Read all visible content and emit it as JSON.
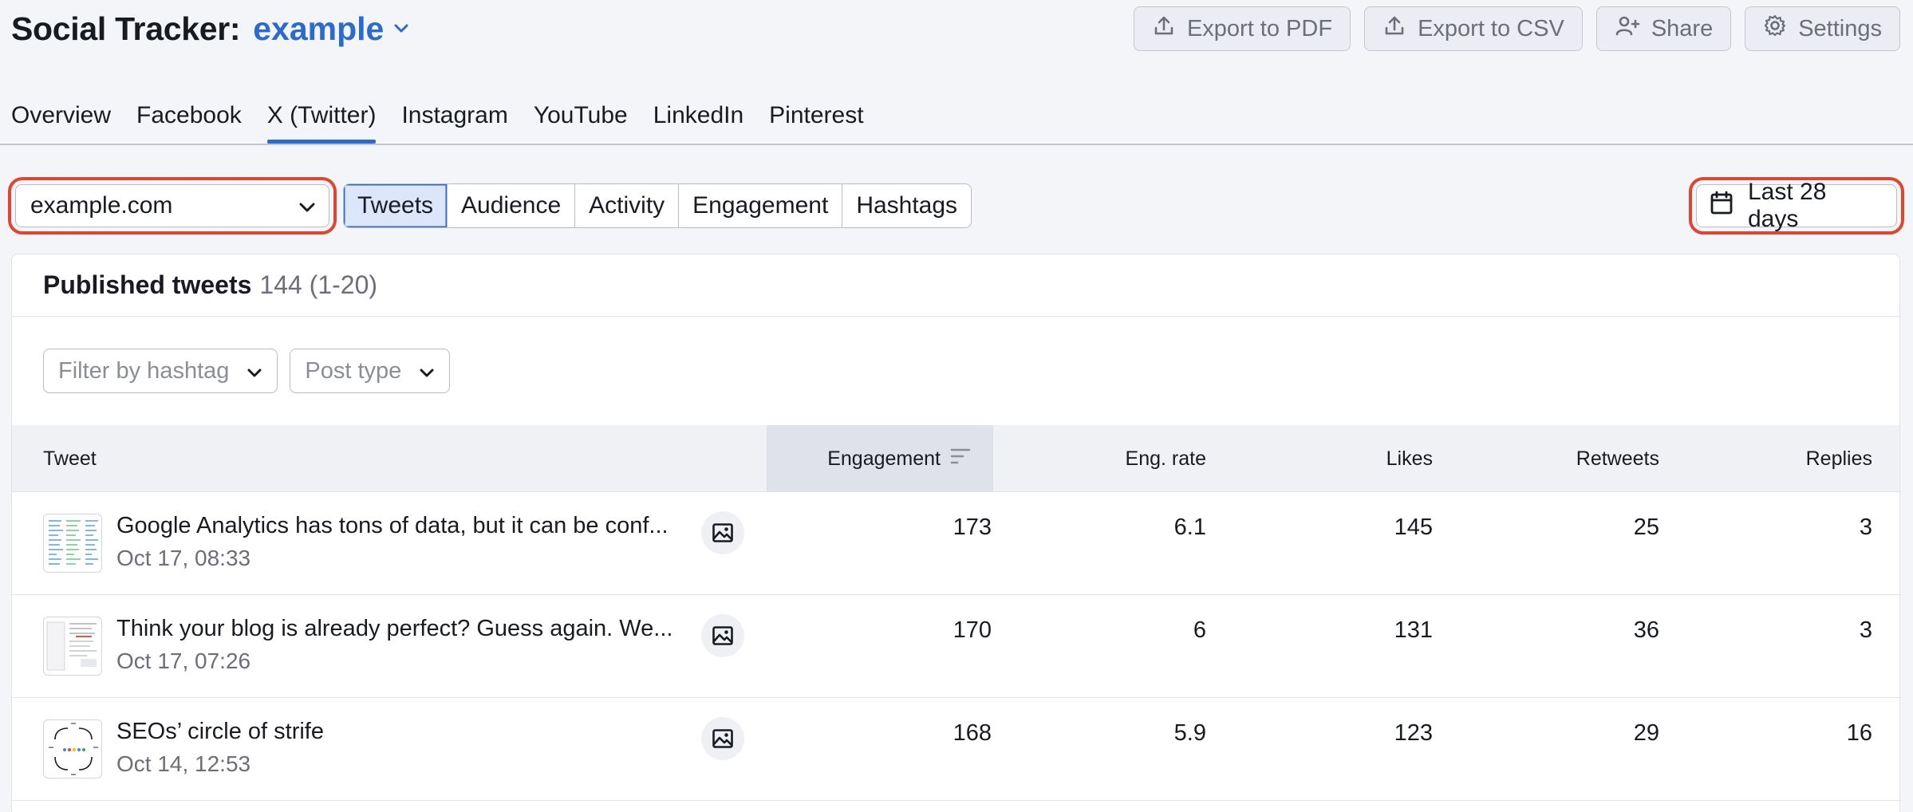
{
  "header": {
    "app_title": "Social Tracker:",
    "project_name": "example",
    "actions": {
      "export_pdf": "Export to PDF",
      "export_csv": "Export to CSV",
      "share": "Share",
      "settings": "Settings"
    }
  },
  "network_tabs": [
    "Overview",
    "Facebook",
    "X (Twitter)",
    "Instagram",
    "YouTube",
    "LinkedIn",
    "Pinterest"
  ],
  "active_network_tab": "X (Twitter)",
  "domain_select": {
    "value": "example.com"
  },
  "sub_tabs": [
    "Tweets",
    "Audience",
    "Activity",
    "Engagement",
    "Hashtags"
  ],
  "active_sub_tab": "Tweets",
  "date_range": {
    "label": "Last 28 days"
  },
  "card": {
    "title": "Published tweets",
    "count": "144 (1-20)",
    "filters": {
      "hashtag_placeholder": "Filter by hashtag",
      "post_type_placeholder": "Post type"
    }
  },
  "table": {
    "columns": {
      "tweet": "Tweet",
      "engagement": "Engagement",
      "eng_rate": "Eng. rate",
      "likes": "Likes",
      "retweets": "Retweets",
      "replies": "Replies"
    },
    "sorted_by": "Engagement",
    "rows": [
      {
        "text": "Google Analytics has tons of data, but it can be conf...",
        "date": "Oct 17, 08:33",
        "media": "image-icon",
        "engagement": "173",
        "eng_rate": "6.1",
        "likes": "145",
        "retweets": "25",
        "replies": "3"
      },
      {
        "text": "Think your blog is already perfect? Guess again. We...",
        "date": "Oct 17, 07:26",
        "media": "image-icon",
        "engagement": "170",
        "eng_rate": "6",
        "likes": "131",
        "retweets": "36",
        "replies": "3"
      },
      {
        "text": "SEOs’ circle of strife",
        "date": "Oct 14, 12:53",
        "media": "image-icon",
        "engagement": "168",
        "eng_rate": "5.9",
        "likes": "123",
        "retweets": "29",
        "replies": "16"
      }
    ]
  },
  "colors": {
    "accent": "#2b6ad1",
    "highlight": "#e0462e",
    "text": "#191b23",
    "muted": "#6c6e79"
  }
}
